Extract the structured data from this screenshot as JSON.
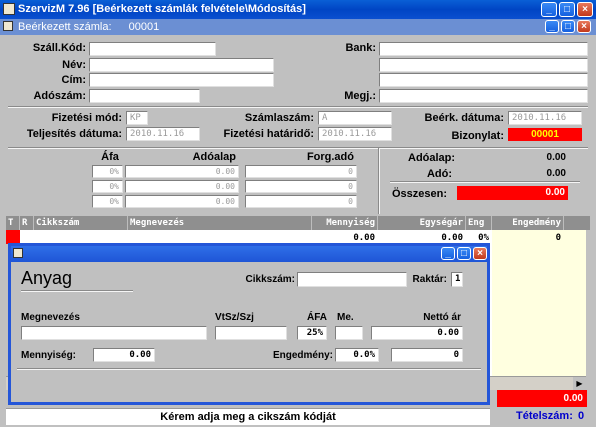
{
  "app": {
    "title": "SzervizM 7.96  [Beérkezett számlák felvétele\\Módosítás]",
    "min": "_",
    "max": "□",
    "close": "×"
  },
  "child": {
    "title": "Beérkezett számla:",
    "number": "00001"
  },
  "form": {
    "szall_kod_label": "Száll.Kód:",
    "nev_label": "Név:",
    "cim_label": "Cím:",
    "adoszam_label": "Adószám:",
    "bank_label": "Bank:",
    "megj_label": "Megj.:",
    "fizetesi_mod_label": "Fizetési mód:",
    "fizetesi_mod_value": "KP",
    "teljesites_label": "Teljesítés dátuma:",
    "teljesites_value": "2010.11.16",
    "szamlaszam_label": "Számlaszám:",
    "szamlaszam_value": "A",
    "hatarido_label": "Fizetési határidő:",
    "hatarido_value": "2010.11.16",
    "beerk_label": "Beérk. dátuma:",
    "beerk_value": "2010.11.16",
    "bizonylat_label": "Bizonylat:",
    "bizonylat_value": "00001"
  },
  "vat": {
    "afa_header": "Áfa",
    "adoalap_header": "Adóalap",
    "forgado_header": "Forg.adó",
    "rows": [
      {
        "afa": "0%",
        "adoalap": "0.00",
        "forg": "0"
      },
      {
        "afa": "0%",
        "adoalap": "0.00",
        "forg": "0"
      },
      {
        "afa": "0%",
        "adoalap": "0.00",
        "forg": "0"
      }
    ],
    "adoalap_label": "Adóalap:",
    "adoalap_total": "0.00",
    "ado_label": "Adó:",
    "ado_total": "0.00",
    "osszesen_label": "Összesen:",
    "osszesen_total": "0.00"
  },
  "grid": {
    "headers": [
      "T",
      "R",
      "Cikkszám",
      "Megnevezés",
      "Mennyiség",
      "Egységár",
      "Eng",
      "Engedmény"
    ],
    "row": {
      "mennyiseg": "0.00",
      "egysegar": "0.00",
      "eng": "0%",
      "engedmeny": "0"
    }
  },
  "dialog": {
    "title": "Anyag",
    "cikkszam_label": "Cikkszám:",
    "raktar_label": "Raktár:",
    "raktar_value": "1",
    "megnevezes_label": "Megnevezés",
    "vtsz_label": "VtSz/Szj",
    "afa_label": "ÁFA",
    "afa_value": "25%",
    "me_label": "Me.",
    "netto_label": "Nettó ár",
    "netto_value": "0.00",
    "mennyiseg_label": "Mennyiség:",
    "mennyiseg_value": "0.00",
    "engedmeny_label": "Engedmény:",
    "engedmeny_pct": "0.0%",
    "engedmeny_value": "0"
  },
  "footer": {
    "total_value": "0.00",
    "status_text": "Kérem adja meg a cikszám kódját",
    "tetelszam_label": "Tételszám:",
    "tetelszam_value": "0"
  },
  "colors": {
    "accent_red": "#ff0000",
    "xp_blue": "#0a4fd0",
    "footer_blue": "#0000cc"
  }
}
